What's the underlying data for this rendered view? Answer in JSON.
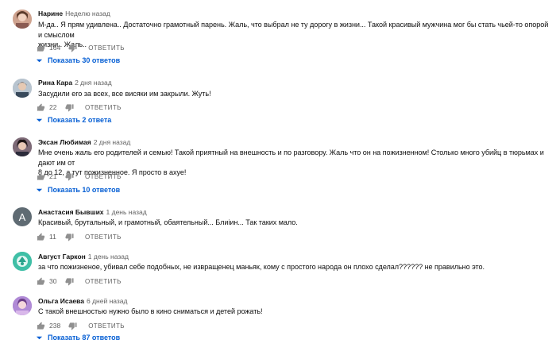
{
  "reply_label": "ОТВЕТИТЬ",
  "comments": [
    {
      "author": "Нарине",
      "time": "Неделю назад",
      "text": "М-да.. Я прям удивлена.. Достаточно грамотный парень. Жаль, что выбрал не ту дорогу в жизни... Такой красивый мужчина мог бы стать чьей-то опорой и смыслом\nжизни.. Жаль..",
      "likes": "164",
      "replies": "Показать 30 ответов",
      "avatar": "photo"
    },
    {
      "author": "Рина Кара",
      "time": "2 дня назад",
      "text": "Засудили его за всех, все висяки им закрыли. Жуть!",
      "likes": "22",
      "replies": "Показать 2 ответа",
      "avatar": "photo"
    },
    {
      "author": "Эксан Любимая",
      "time": "2 дня назад",
      "text": "Мне очень жаль его родителей и семью! Такой приятный на внешность и по разговору. Жаль что он на пожизненном! Столько много убийц в тюрьмах и дают им от\n8 до 12, а тут пожизненное. Я просто в ахуе!",
      "likes": "21",
      "replies": "Показать 10 ответов",
      "avatar": "photo"
    },
    {
      "author": "Анастасия Бывших",
      "time": "1 день назад",
      "text": "Красивый, брутальный, и грамотный, обаятельный... Блиiин... Так таких мало.",
      "likes": "11",
      "replies": "",
      "avatar": "A",
      "avatar_color": "#5f6b73"
    },
    {
      "author": "Август Гаркон",
      "time": "1 день назад",
      "text": "за что пожизненое, убивал себе подобных, не извращенец маньяк, кому с простого народа он плохо сделал?????? не правильно это.",
      "likes": "30",
      "replies": "",
      "avatar": "photo"
    },
    {
      "author": "Ольга Исаева",
      "time": "6 дней назад",
      "text": "С такой внешностью нужно было в кино сниматься и детей рожать!",
      "likes": "238",
      "replies": "Показать 87 ответов",
      "avatar": "photo"
    }
  ]
}
